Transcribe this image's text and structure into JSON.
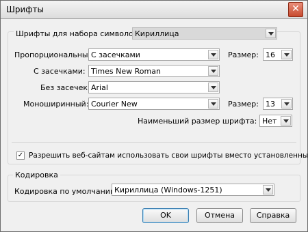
{
  "window": {
    "title": "Шрифты",
    "close_glyph": "✕"
  },
  "fonts_group": {
    "legend": "Шрифты для набора символов:",
    "charset_value": "Кириллица",
    "proportional_label": "Пропорциональный",
    "proportional_value": "С засечками",
    "size_label": "Размер:",
    "proportional_size": "16",
    "serif_label": "С засечками:",
    "serif_value": "Times New Roman",
    "sans_label": "Без засечек:",
    "sans_value": "Arial",
    "mono_label": "Моноширинный:",
    "mono_value": "Courier New",
    "mono_size_label": "Размер:",
    "mono_size": "13",
    "min_size_label": "Наименьший размер шрифта:",
    "min_size_value": "Нет"
  },
  "allow_fonts": {
    "checked_glyph": "✓",
    "label": "Разрешить веб-сайтам использовать свои шрифты вместо установленных"
  },
  "encoding_group": {
    "legend": "Кодировка",
    "default_label": "Кодировка по умолчанию:",
    "default_value": "Кириллица (Windows-1251)"
  },
  "buttons": {
    "ok": "OK",
    "cancel": "Отмена",
    "help": "Справка"
  }
}
